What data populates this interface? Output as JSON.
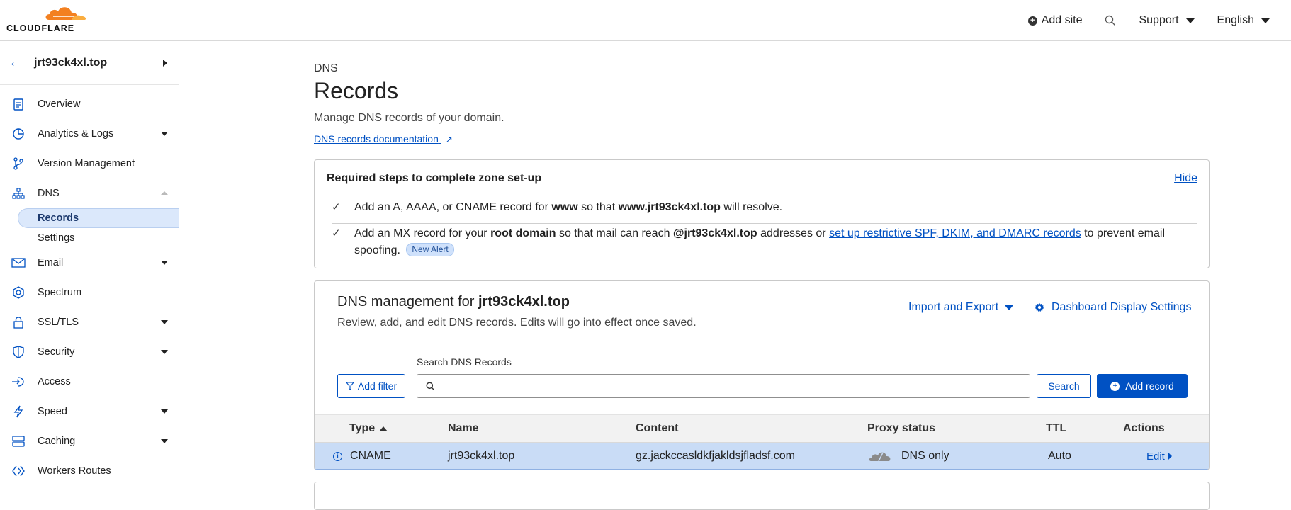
{
  "brand": {
    "logo_text": "CLOUDFLARE",
    "logo_color": "#f38020"
  },
  "topbar": {
    "add_site": "Add site",
    "support": "Support",
    "language": "English",
    "icons": [
      "search-icon"
    ]
  },
  "sidebar": {
    "zone_name": "jrt93ck4xl.top",
    "items": [
      {
        "label": "Overview",
        "icon": "clipboard-icon"
      },
      {
        "label": "Analytics & Logs",
        "icon": "pie-chart-icon"
      },
      {
        "label": "Version Management",
        "icon": "branch-icon"
      },
      {
        "label": "DNS",
        "icon": "sitemap-icon"
      },
      {
        "label": "Email",
        "icon": "envelope-icon"
      },
      {
        "label": "Spectrum",
        "icon": "spectrum-icon"
      },
      {
        "label": "SSL/TLS",
        "icon": "lock-icon"
      },
      {
        "label": "Security",
        "icon": "shield-icon"
      },
      {
        "label": "Access",
        "icon": "access-icon"
      },
      {
        "label": "Speed",
        "icon": "lightning-icon"
      },
      {
        "label": "Caching",
        "icon": "database-icon"
      },
      {
        "label": "Workers Routes",
        "icon": "workers-icon"
      }
    ],
    "dns_subitems": [
      "Records",
      "Settings"
    ]
  },
  "page": {
    "eyebrow": "DNS",
    "title": "Records",
    "description": "Manage DNS records of your domain.",
    "doc_link": "DNS records documentation"
  },
  "steps": {
    "title": "Required steps to complete zone set-up",
    "hide": "Hide",
    "step1": {
      "a": "Add an A, AAAA, or CNAME record for ",
      "b": "www",
      "c": " so that ",
      "d": "www.jrt93ck4xl.top",
      "e": " will resolve."
    },
    "step2": {
      "a": "Add an MX record for your ",
      "b": "root domain",
      "c": " so that mail can reach ",
      "d": "@jrt93ck4xl.top",
      "e": " addresses or ",
      "link": "set up restrictive SPF, DKIM, and DMARC records",
      "f": " to prevent email",
      "g": "spoofing.",
      "badge": "New Alert"
    }
  },
  "management": {
    "title_prefix": "DNS management for ",
    "zone": "jrt93ck4xl.top",
    "description": "Review, add, and edit DNS records. Edits will go into effect once saved.",
    "import_export": "Import and Export",
    "display_settings": "Dashboard Display Settings",
    "add_filter": "Add filter",
    "search_label": "Search DNS Records",
    "search_value": "",
    "search_button": "Search",
    "add_record": "Add record",
    "columns": [
      "Type",
      "Name",
      "Content",
      "Proxy status",
      "TTL",
      "Actions"
    ],
    "rows": [
      {
        "type": "CNAME",
        "name": "jrt93ck4xl.top",
        "content": "gz.jackccasldkfjakldsjfladsf.com",
        "proxy_status": "DNS only",
        "ttl": "Auto",
        "action": "Edit"
      }
    ]
  },
  "colors": {
    "accent": "#0051c3",
    "selected_row": "#c9dcf6",
    "brand_orange": "#f38020"
  }
}
